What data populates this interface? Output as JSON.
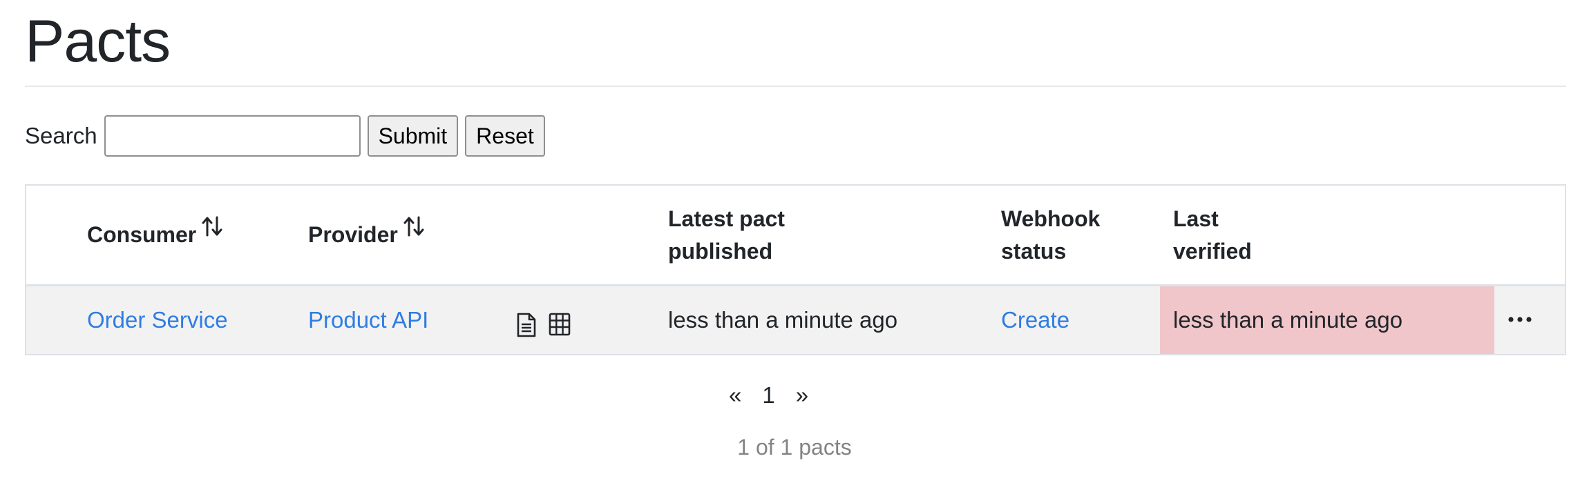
{
  "page": {
    "title": "Pacts"
  },
  "search": {
    "label": "Search",
    "value": "",
    "placeholder": "",
    "submit_label": "Submit",
    "reset_label": "Reset"
  },
  "table": {
    "headers": {
      "consumer": "Consumer",
      "provider": "Provider",
      "latest_pact_line1": "Latest pact",
      "latest_pact_line2": "published",
      "webhook_line1": "Webhook",
      "webhook_line2": "status",
      "last_verified_line1": "Last",
      "last_verified_line2": "verified"
    },
    "rows": [
      {
        "consumer": "Order Service",
        "provider": "Product API",
        "icons": [
          "document-icon",
          "matrix-table-icon",
          "more-options-icon"
        ],
        "latest_pact_published": "less than a minute ago",
        "webhook_status": "Create",
        "last_verified": "less than a minute ago",
        "last_verified_status_color": "#f0c6ca"
      }
    ]
  },
  "pagination": {
    "prev": "«",
    "page": "1",
    "next": "»"
  },
  "summary": "1 of 1 pacts",
  "colors": {
    "link": "#2f7de1",
    "row_background": "#f2f2f2",
    "failed_verification": "#f0c6ca"
  }
}
